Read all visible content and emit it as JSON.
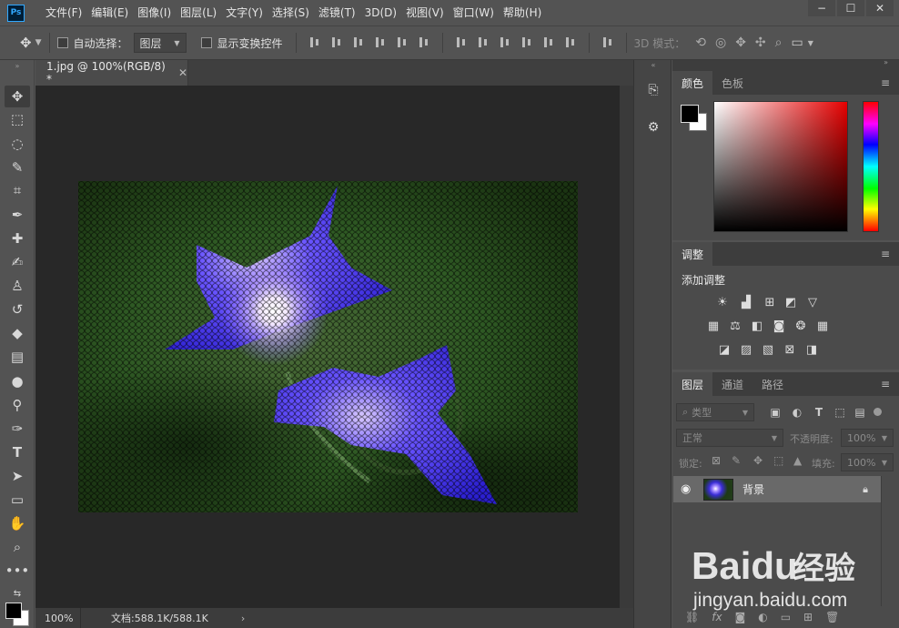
{
  "app": {
    "logo_text": "Ps"
  },
  "menu": [
    "文件(F)",
    "编辑(E)",
    "图像(I)",
    "图层(L)",
    "文字(Y)",
    "选择(S)",
    "滤镜(T)",
    "3D(D)",
    "视图(V)",
    "窗口(W)",
    "帮助(H)"
  ],
  "window_controls": [
    "−",
    "☐",
    "✕"
  ],
  "options": {
    "auto_select_label": "自动选择：",
    "auto_select_value": "图层",
    "show_transform_label": "显示变换控件",
    "mode_3d_label": "3D 模式："
  },
  "document": {
    "tab_title": "1.jpg @ 100%(RGB/8) *",
    "close_glyph": "✕",
    "zoom": "100%",
    "doc_info": "文档:588.1K/588.1K",
    "status_arrow": "›"
  },
  "color_panel": {
    "tabs": [
      "颜色",
      "色板"
    ]
  },
  "adjust_panel": {
    "tab": "调整",
    "title": "添加调整"
  },
  "layers_panel": {
    "tabs": [
      "图层",
      "通道",
      "路径"
    ],
    "filter_kind": "类型",
    "blend_mode": "正常",
    "opacity_label": "不透明度:",
    "opacity_value": "100%",
    "lock_label": "锁定:",
    "fill_label": "填充:",
    "fill_value": "100%",
    "layer_name": "背景"
  },
  "watermark": {
    "brand": "Baidu",
    "brand_cn": "经验",
    "url": "jingyan.baidu.com"
  },
  "colors": {
    "foreground": "#000000",
    "background": "#ffffff",
    "accent": "#31a8ff"
  }
}
